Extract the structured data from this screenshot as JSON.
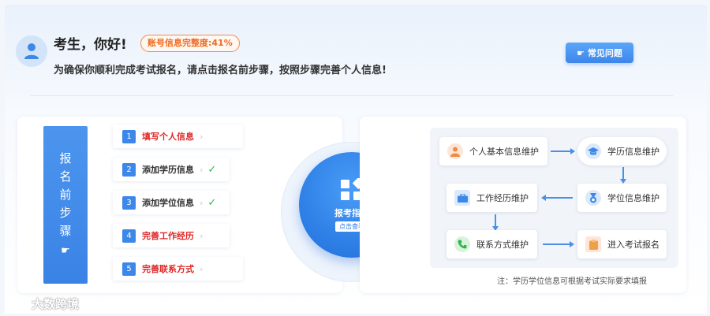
{
  "header": {
    "greeting": "考生，你好!",
    "completeness_badge": "账号信息完整度:41%",
    "instruction": "为确保你顺利完成考试报名，请点击报名前步骤，按照步骤完善个人信息!",
    "faq_button": "常见问题"
  },
  "steps_banner": {
    "chars": [
      "报",
      "名",
      "前",
      "步",
      "骤"
    ]
  },
  "steps": [
    {
      "num": "1",
      "label": "填写个人信息",
      "status": "pending"
    },
    {
      "num": "2",
      "label": "添加学历信息",
      "status": "done"
    },
    {
      "num": "3",
      "label": "添加学位信息",
      "status": "done"
    },
    {
      "num": "4",
      "label": "完善工作经历",
      "status": "pending"
    },
    {
      "num": "5",
      "label": "完善联系方式",
      "status": "pending"
    }
  ],
  "guide": {
    "title": "报考指南",
    "button": "点击查看"
  },
  "flow": {
    "personal": "个人基本信息维护",
    "education": "学历信息维护",
    "work": "工作经历维护",
    "degree": "学位信息维护",
    "contact": "联系方式维护",
    "enter": "进入考试报名"
  },
  "note": "注：学历学位信息可根据考试实际要求填报",
  "watermark": "大数跨境",
  "colors": {
    "accent": "#3c88ea",
    "pending_red": "#e02828",
    "done_green": "#2fb44a",
    "badge_orange": "#f06a1e"
  }
}
